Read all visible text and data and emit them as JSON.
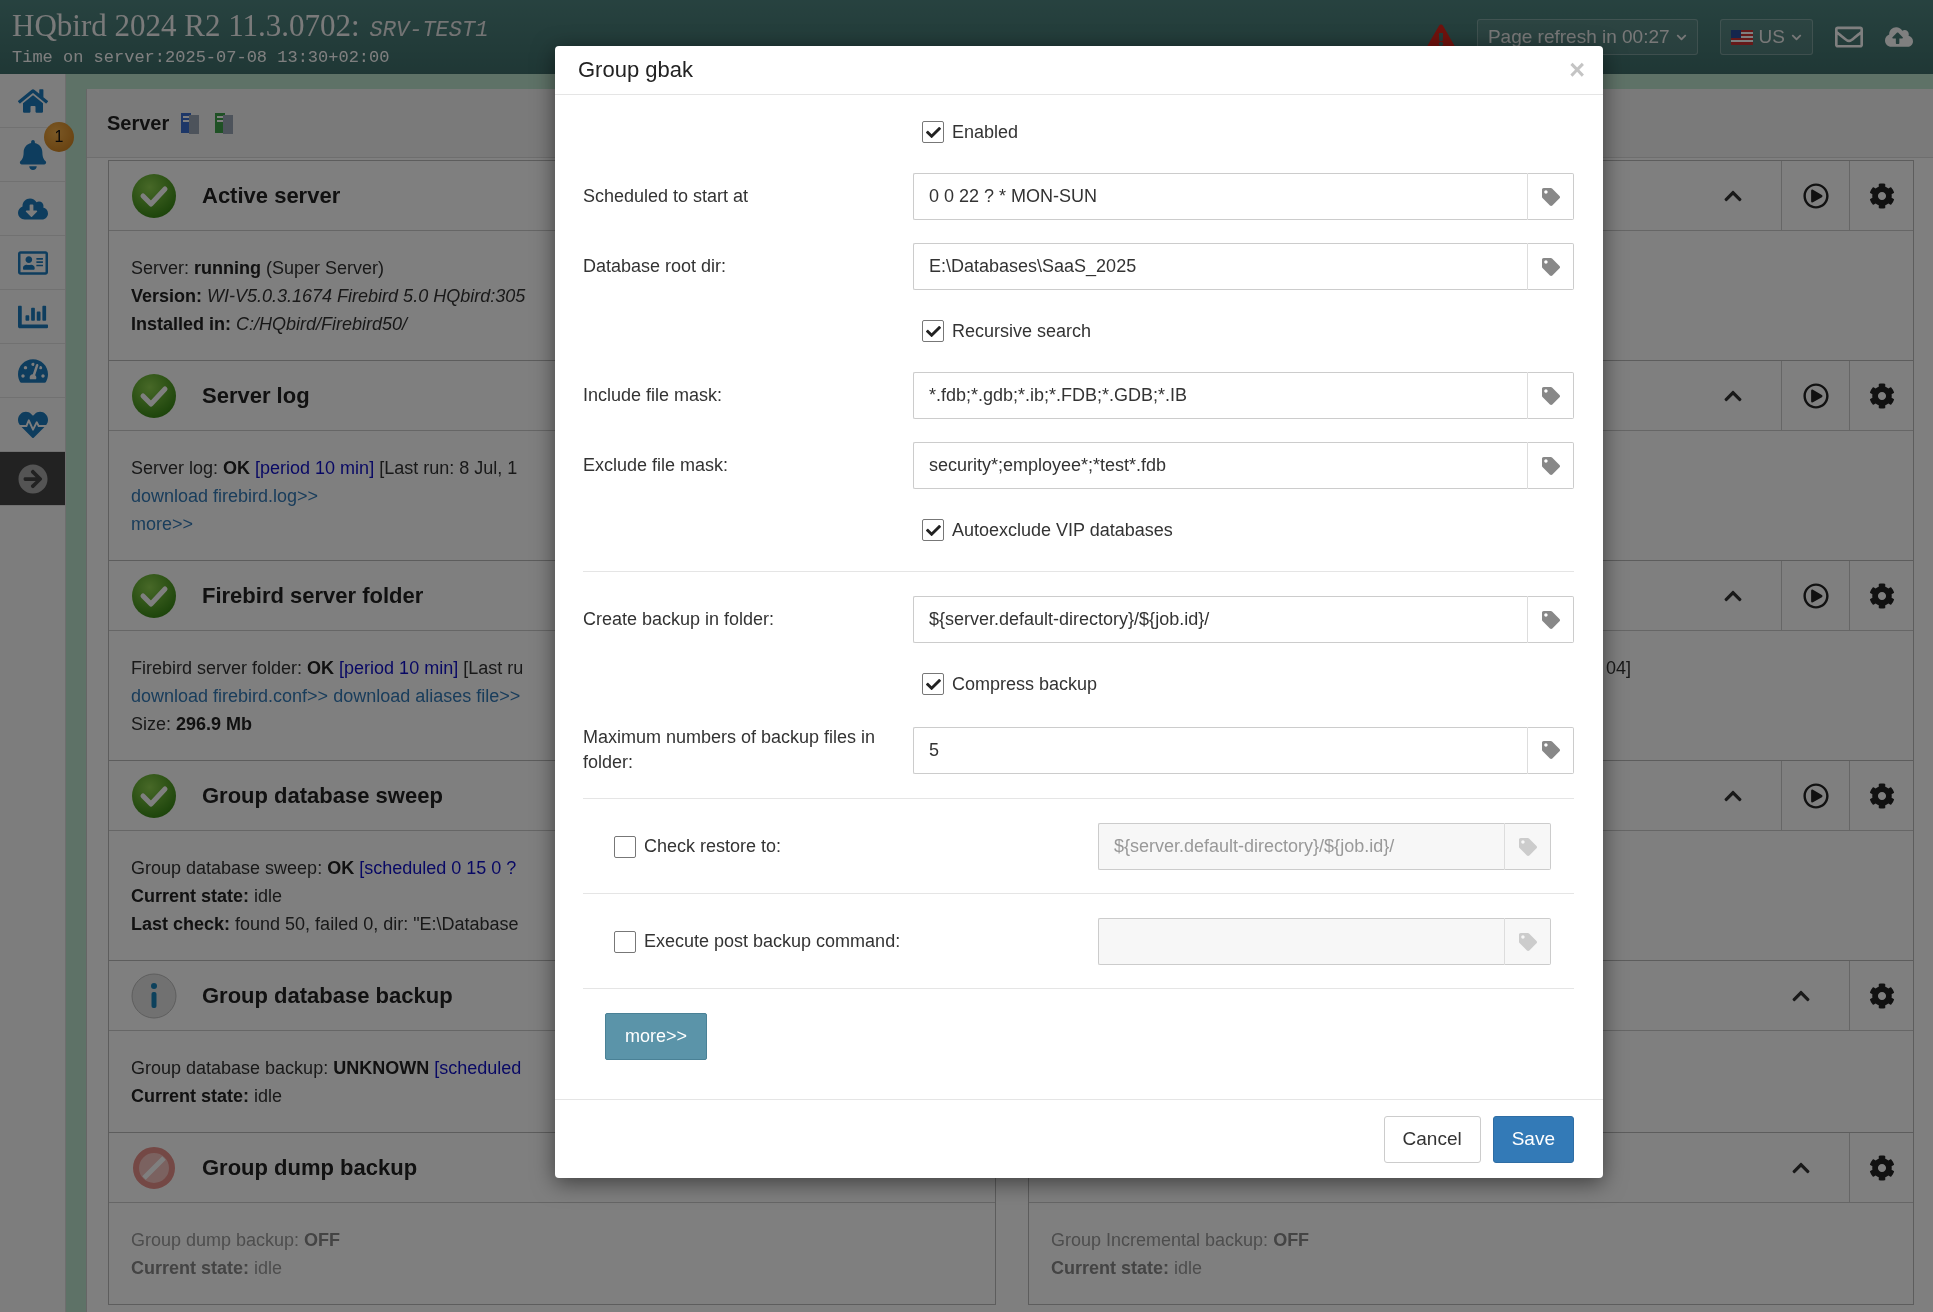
{
  "header": {
    "title": "HQbird 2024 R2 11.3.0702:",
    "server": "SRV-TEST1",
    "time": "Time on server:2025-07-08 13:30+02:00",
    "refresh": "Page refresh in 00:27",
    "language": "US"
  },
  "sidebar": {
    "items": [
      {
        "selected": false
      },
      {
        "selected": false,
        "badge": "1"
      },
      {
        "selected": false
      },
      {
        "selected": false
      },
      {
        "selected": false
      },
      {
        "selected": false
      },
      {
        "selected": false
      },
      {
        "selected": true
      }
    ]
  },
  "panel": {
    "title": "Server"
  },
  "left_cards": [
    {
      "kind": "ok",
      "title": "Active server",
      "disabled": false,
      "lines": [
        [
          {
            "kind": "plain",
            "text": "Server: "
          },
          {
            "kind": "bold",
            "text": "running"
          },
          {
            "kind": "plain",
            "text": " (Super Server)"
          }
        ],
        [
          {
            "kind": "bold",
            "text": "Version: "
          },
          {
            "kind": "italic",
            "text": "WI-V5.0.3.1674 Firebird 5.0 HQbird:305"
          }
        ],
        [
          {
            "kind": "bold",
            "text": "Installed in: "
          },
          {
            "kind": "italic",
            "text": "C:/HQbird/Firebird50/"
          }
        ]
      ]
    },
    {
      "kind": "ok",
      "title": "Server log",
      "disabled": false,
      "lines": [
        [
          {
            "kind": "plain",
            "text": "Server log: "
          },
          {
            "kind": "bold",
            "text": "OK"
          },
          {
            "kind": "note",
            "text": "[period 10 min]"
          },
          {
            "kind": "plain",
            "text": "[Last run: 8 Jul, 1"
          }
        ],
        [
          {
            "kind": "link",
            "text": "download firebird.log>>"
          }
        ],
        [
          {
            "kind": "link",
            "text": "more>>"
          }
        ]
      ]
    },
    {
      "kind": "ok",
      "title": "Firebird server folder",
      "disabled": false,
      "lines": [
        [
          {
            "kind": "plain",
            "text": "Firebird server folder: "
          },
          {
            "kind": "bold",
            "text": "OK"
          },
          {
            "kind": "note",
            "text": "[period 10 min]"
          },
          {
            "kind": "plain",
            "text": "[Last ru"
          }
        ],
        [
          {
            "kind": "link",
            "text": "download firebird.conf>>"
          },
          {
            "kind": "link",
            "text": "download aliases file>>"
          }
        ],
        [
          {
            "kind": "plain",
            "text": "Size: "
          },
          {
            "kind": "bold",
            "text": "296.9 Mb"
          }
        ]
      ]
    },
    {
      "kind": "ok",
      "title": "Group database sweep",
      "disabled": false,
      "lines": [
        [
          {
            "kind": "plain",
            "text": "Group database sweep: "
          },
          {
            "kind": "bold",
            "text": "OK"
          },
          {
            "kind": "note",
            "text": "[scheduled 0 15 0 ?"
          }
        ],
        [
          {
            "kind": "bold",
            "text": "Current state: "
          },
          {
            "kind": "plain",
            "text": "idle"
          }
        ],
        [
          {
            "kind": "bold",
            "text": "Last check: "
          },
          {
            "kind": "plain",
            "text": "found 50, failed 0, dir: \"E:\\Database"
          }
        ]
      ]
    },
    {
      "kind": "info",
      "title": "Group database backup",
      "disabled": false,
      "lines": [
        [
          {
            "kind": "plain",
            "text": "Group database backup: "
          },
          {
            "kind": "bold",
            "text": "UNKNOWN"
          },
          {
            "kind": "note",
            "text": "[scheduled"
          }
        ],
        [
          {
            "kind": "bold",
            "text": "Current state: "
          },
          {
            "kind": "plain",
            "text": "idle"
          }
        ]
      ]
    },
    {
      "kind": "off",
      "title": "Group dump backup",
      "disabled": true,
      "lines": [
        [
          {
            "kind": "plain",
            "text": "Group dump backup: "
          },
          {
            "kind": "bold",
            "text": "OFF"
          }
        ],
        [
          {
            "kind": "bold",
            "text": "Current state: "
          },
          {
            "kind": "plain",
            "text": "idle"
          }
        ]
      ]
    }
  ],
  "right_cards": [
    {
      "runnable": true
    },
    {
      "runnable": true
    },
    {
      "runnable": true,
      "disabled": false,
      "tail": "04]"
    },
    {
      "runnable": true
    },
    {
      "runnable": false
    },
    {
      "runnable": false,
      "disabled": true,
      "lines": [
        [
          {
            "kind": "plain",
            "text": "Group Incremental backup: "
          },
          {
            "kind": "bold",
            "text": "OFF"
          }
        ],
        [
          {
            "kind": "bold",
            "text": "Current state: "
          },
          {
            "kind": "plain",
            "text": "idle"
          }
        ]
      ]
    }
  ],
  "dialog": {
    "title": "Group gbak",
    "close": "×",
    "rows": [
      {
        "kind": "checkbox",
        "label": "Enabled",
        "checked": true
      },
      {
        "kind": "field",
        "label": "Scheduled to start at",
        "value": "0 0 22 ? * MON-SUN"
      },
      {
        "kind": "field",
        "label": "Database root dir:",
        "value": "E:\\Databases\\SaaS_2025"
      },
      {
        "kind": "checkbox",
        "label": "Recursive search",
        "checked": true
      },
      {
        "kind": "field",
        "label": "Include file mask:",
        "value": "*.fdb;*.gdb;*.ib;*.FDB;*.GDB;*.IB"
      },
      {
        "kind": "field",
        "label": "Exclude file mask:",
        "value": "security*;employee*;*test*.fdb"
      },
      {
        "kind": "checkbox",
        "label": "Autoexclude VIP databases",
        "checked": true
      },
      {
        "kind": "divider"
      },
      {
        "kind": "field",
        "label": "Create backup in folder:",
        "value": "${server.default-directory}/${job.id}/"
      },
      {
        "kind": "checkbox",
        "label": "Compress backup",
        "checked": true
      },
      {
        "kind": "field",
        "label": "Maximum numbers of backup files in folder:",
        "value": "5"
      },
      {
        "kind": "divider"
      },
      {
        "kind": "option",
        "label": "Check restore to:",
        "checked": false,
        "placeholder": "${server.default-directory}/${job.id}/"
      },
      {
        "kind": "divider"
      },
      {
        "kind": "option",
        "label": "Execute post backup command:",
        "checked": false
      },
      {
        "kind": "divider"
      }
    ],
    "more": "more>>",
    "buttons": [
      {
        "label": "Cancel",
        "primary": false
      },
      {
        "label": "Save",
        "primary": true
      }
    ]
  }
}
